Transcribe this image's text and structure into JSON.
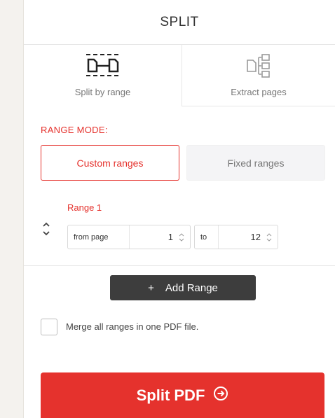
{
  "header": {
    "title": "SPLIT"
  },
  "tabs": [
    {
      "label": "Split by range",
      "icon": "split-range-icon",
      "selected": true
    },
    {
      "label": "Extract pages",
      "icon": "extract-pages-icon",
      "selected": false
    }
  ],
  "range_mode": {
    "label": "RANGE MODE:",
    "options": [
      {
        "label": "Custom ranges",
        "selected": true
      },
      {
        "label": "Fixed ranges",
        "selected": false
      }
    ]
  },
  "ranges": [
    {
      "title": "Range 1",
      "from_label": "from page",
      "from_value": "1",
      "to_label": "to",
      "to_value": "12"
    }
  ],
  "add_range": {
    "icon_text": "+",
    "label": "Add Range"
  },
  "merge": {
    "label": "Merge all ranges in one PDF file.",
    "checked": false
  },
  "submit": {
    "label": "Split PDF",
    "icon": "arrow-right-circle-icon"
  },
  "colors": {
    "accent": "#e5322d",
    "dark_button": "#3d3d3d",
    "success": "#5cb85c"
  }
}
